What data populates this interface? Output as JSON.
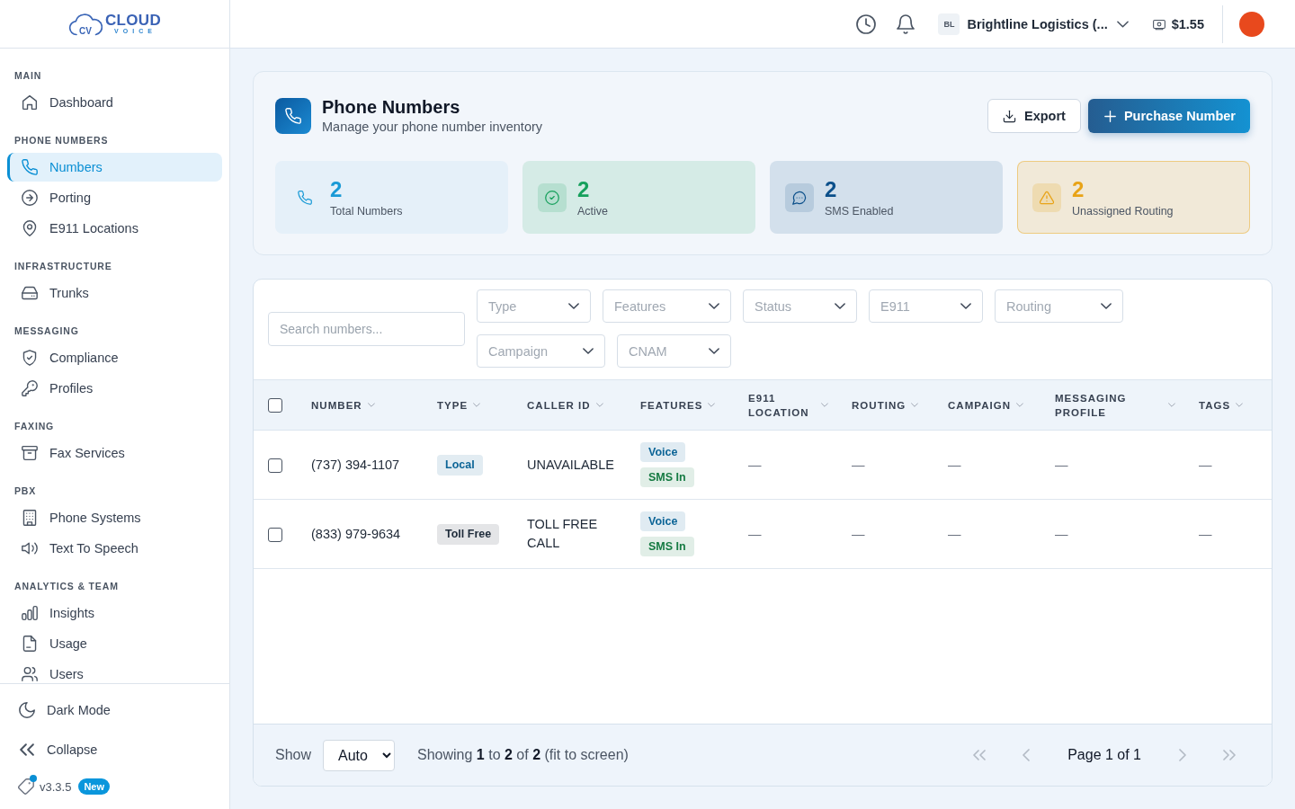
{
  "sidebar": {
    "logo": {
      "monogram": "CV",
      "name": "CLOUD",
      "tagline": "VOICE"
    },
    "sections": [
      {
        "label": "MAIN",
        "items": [
          {
            "label": "Dashboard",
            "selected": false
          }
        ]
      },
      {
        "label": "PHONE NUMBERS",
        "items": [
          {
            "label": "Numbers",
            "selected": true
          },
          {
            "label": "Porting",
            "selected": false
          },
          {
            "label": "E911 Locations",
            "selected": false
          }
        ]
      },
      {
        "label": "INFRASTRUCTURE",
        "items": [
          {
            "label": "Trunks",
            "selected": false
          }
        ]
      },
      {
        "label": "MESSAGING",
        "items": [
          {
            "label": "Compliance",
            "selected": false
          },
          {
            "label": "Profiles",
            "selected": false
          }
        ]
      },
      {
        "label": "FAXING",
        "items": [
          {
            "label": "Fax Services",
            "selected": false
          }
        ]
      },
      {
        "label": "PBX",
        "items": [
          {
            "label": "Phone Systems",
            "selected": false
          },
          {
            "label": "Text To Speech",
            "selected": false
          }
        ]
      },
      {
        "label": "ANALYTICS & TEAM",
        "items": [
          {
            "label": "Insights",
            "selected": false
          },
          {
            "label": "Usage",
            "selected": false
          },
          {
            "label": "Users",
            "selected": false
          }
        ]
      }
    ],
    "dark_mode": {
      "label": "Dark Mode"
    },
    "collapse": {
      "label": "Collapse"
    },
    "version": {
      "label": "v3.3.5",
      "badge": "New",
      "update_dot": true
    }
  },
  "topbar": {
    "account": {
      "initials": "BL",
      "name": "Brightline Logistics (..."
    },
    "balance": "$1.55"
  },
  "page": {
    "title": "Phone Numbers",
    "subtitle": "Manage your phone number inventory",
    "actions": [
      {
        "label": "Export",
        "kind": "secondary"
      },
      {
        "label": "Purchase Number",
        "kind": "primary"
      }
    ],
    "stats": [
      {
        "value": "2",
        "label": "Total Numbers",
        "kind": "total",
        "color": "#1a9ad6"
      },
      {
        "value": "2",
        "label": "Active",
        "kind": "active",
        "color": "#16a05c"
      },
      {
        "value": "2",
        "label": "SMS Enabled",
        "kind": "sms",
        "color": "#0b4f8a"
      },
      {
        "value": "2",
        "label": "Unassigned Routing",
        "kind": "warning",
        "color": "#e8a317"
      }
    ]
  },
  "filters": {
    "search": {
      "placeholder": "Search numbers..."
    },
    "dropdowns": [
      {
        "placeholder": "Type"
      },
      {
        "placeholder": "Features"
      },
      {
        "placeholder": "Status"
      },
      {
        "placeholder": "E911"
      },
      {
        "placeholder": "Routing"
      },
      {
        "placeholder": "Campaign"
      },
      {
        "placeholder": "CNAM"
      }
    ]
  },
  "table": {
    "select_all": {
      "checked": false
    },
    "columns": [
      {
        "label": "NUMBER"
      },
      {
        "label": "TYPE"
      },
      {
        "label": "CALLER ID"
      },
      {
        "label": "FEATURES"
      },
      {
        "label": "E911 LOCATION"
      },
      {
        "label": "ROUTING"
      },
      {
        "label": "CAMPAIGN"
      },
      {
        "label": "MESSAGING PROFILE"
      },
      {
        "label": "TAGS"
      }
    ],
    "rows": [
      {
        "checked": false,
        "number": "(737) 394-1107",
        "type": {
          "label": "Local",
          "color": "#0d6597"
        },
        "caller_id": "UNAVAILABLE",
        "features": [
          {
            "label": "Voice",
            "color": "#0d6597"
          },
          {
            "label": "SMS In",
            "color": "#157a42"
          }
        ],
        "e911_location": "—",
        "routing": "—",
        "campaign": "—",
        "messaging_profile": "—",
        "tags": "—"
      },
      {
        "checked": false,
        "number": "(833) 979-9634",
        "type": {
          "label": "Toll Free",
          "color": "#1e2b3a"
        },
        "caller_id": "TOLL FREE CALL",
        "features": [
          {
            "label": "Voice",
            "color": "#0d6597"
          },
          {
            "label": "SMS In",
            "color": "#157a42"
          }
        ],
        "e911_location": "—",
        "routing": "—",
        "campaign": "—",
        "messaging_profile": "—",
        "tags": "—"
      }
    ]
  },
  "footer": {
    "show_label": "Show",
    "page_size": "Auto",
    "summary": "Showing **1** to **2** of **2** (fit to screen)",
    "page_label": "Page 1 of 1",
    "pager": [
      {
        "kind": "first",
        "disabled": true
      },
      {
        "kind": "prev",
        "disabled": true
      },
      {
        "kind": "next",
        "disabled": true
      },
      {
        "kind": "last",
        "disabled": true
      }
    ]
  }
}
